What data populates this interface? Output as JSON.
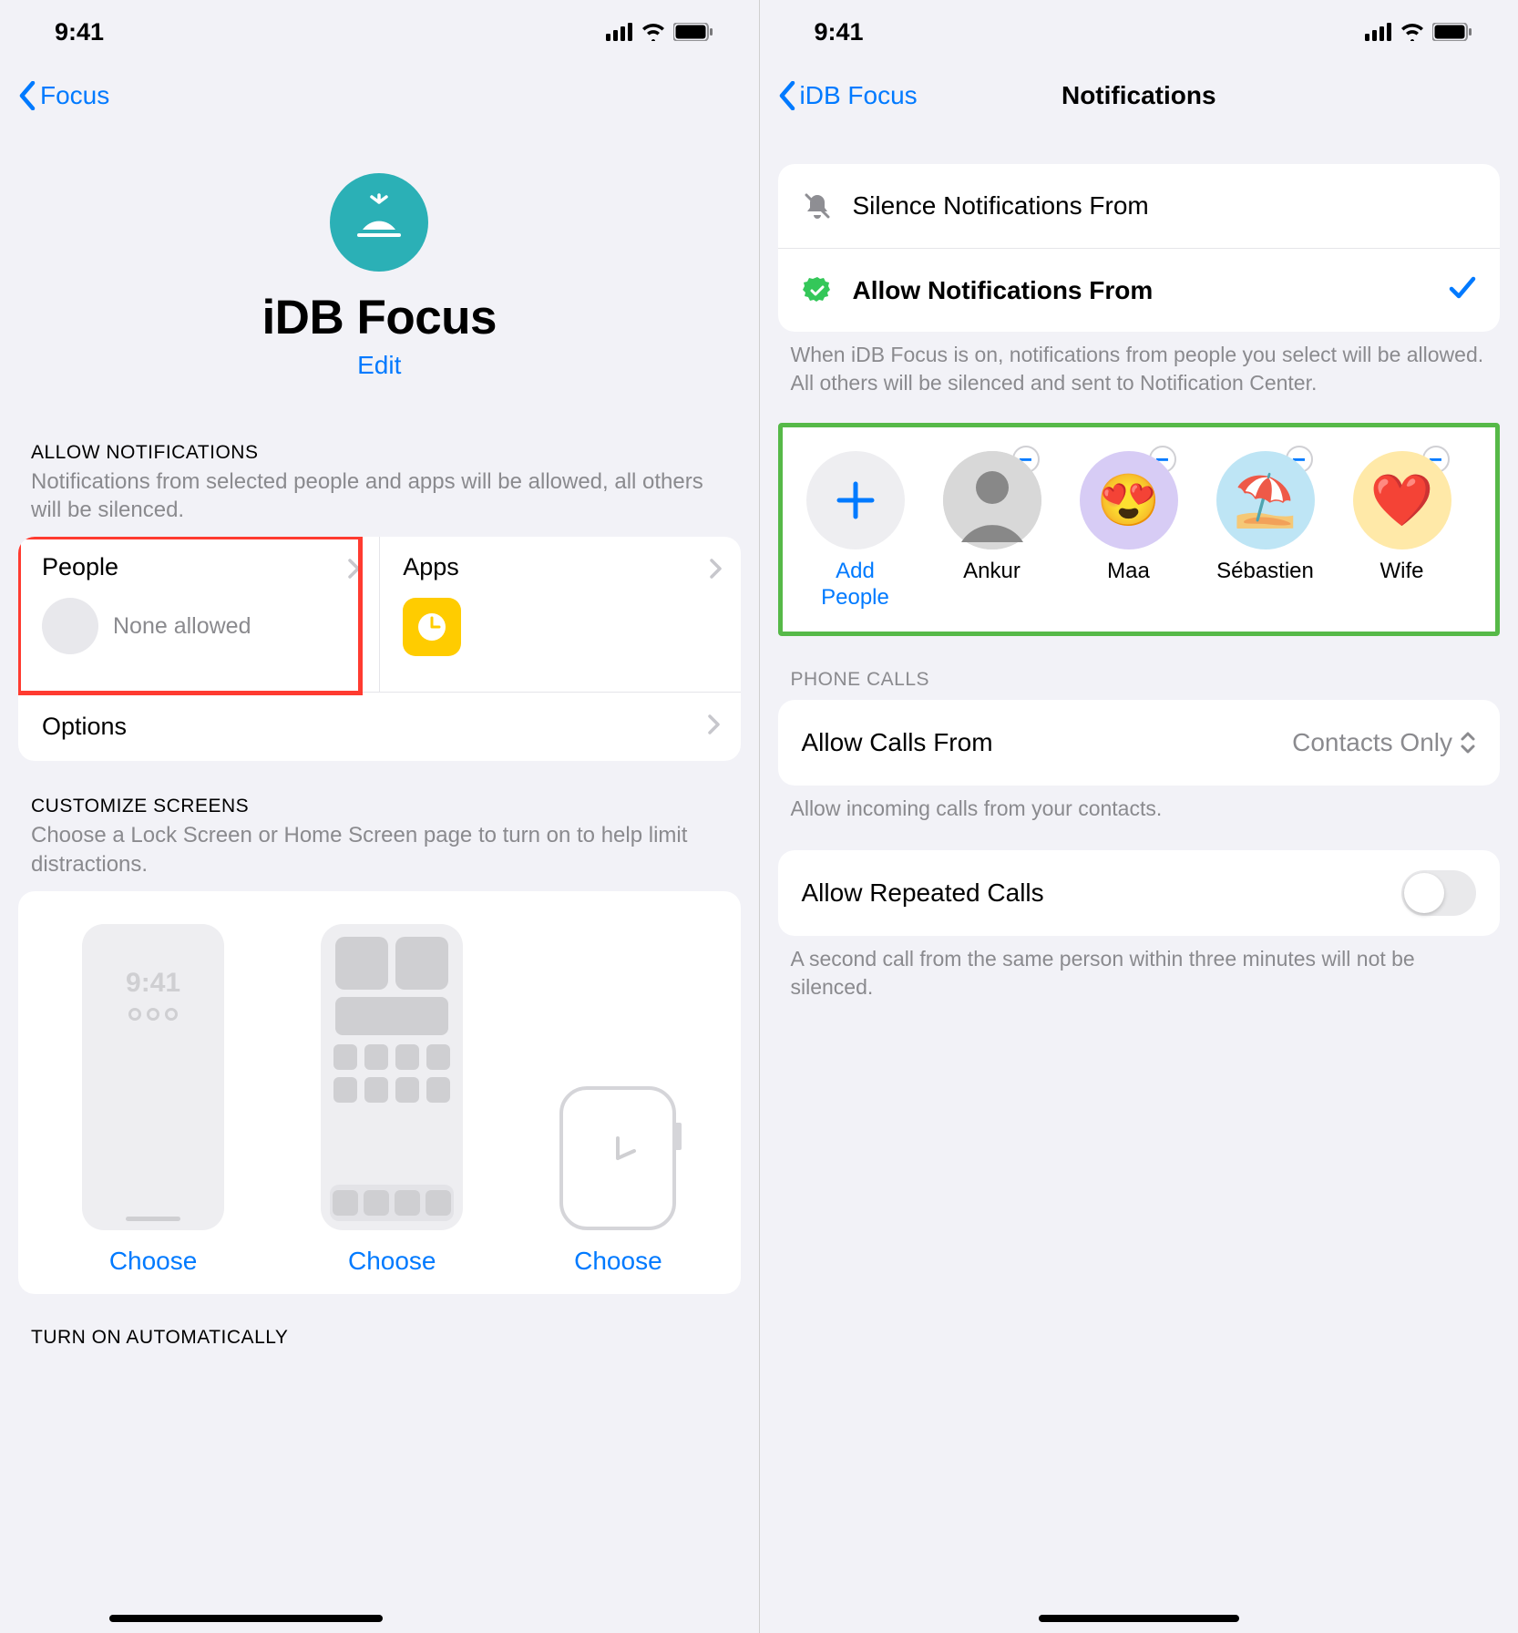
{
  "status": {
    "time": "9:41"
  },
  "left": {
    "back": "Focus",
    "title": "iDB Focus",
    "edit": "Edit",
    "allow_header": "ALLOW NOTIFICATIONS",
    "allow_desc": "Notifications from selected people and apps will be allowed, all others will be silenced.",
    "people_label": "People",
    "people_none": "None allowed",
    "apps_label": "Apps",
    "options_label": "Options",
    "customize_header": "CUSTOMIZE SCREENS",
    "customize_desc": "Choose a Lock Screen or Home Screen page to turn on to help limit distractions.",
    "lock_time": "9:41",
    "choose": "Choose",
    "turn_on_header": "TURN ON AUTOMATICALLY"
  },
  "right": {
    "back": "iDB Focus",
    "title": "Notifications",
    "silence_label": "Silence Notifications From",
    "allow_label": "Allow Notifications From",
    "allow_desc": "When iDB Focus is on, notifications from people you select will be allowed. All others will be silenced and sent to Notification Center.",
    "add_people": "Add People",
    "people": [
      {
        "name": "Ankur",
        "bg": "#d8d8d8",
        "emoji": ""
      },
      {
        "name": "Maa",
        "bg": "#d7ccf5",
        "emoji": "😍"
      },
      {
        "name": "Sébastien",
        "bg": "#bee5f5",
        "emoji": "⛱️"
      },
      {
        "name": "Wife",
        "bg": "#ffe9a8",
        "emoji": "❤️"
      }
    ],
    "phone_calls_header": "PHONE CALLS",
    "allow_calls_label": "Allow Calls From",
    "allow_calls_value": "Contacts Only",
    "allow_calls_desc": "Allow incoming calls from your contacts.",
    "repeated_label": "Allow Repeated Calls",
    "repeated_desc": "A second call from the same person within three minutes will not be silenced."
  }
}
